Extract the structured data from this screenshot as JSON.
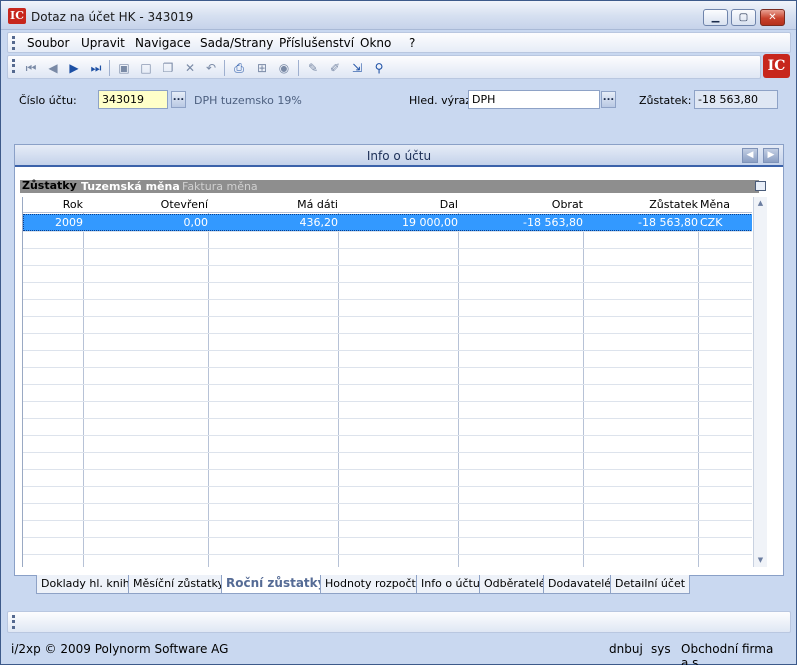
{
  "window": {
    "title": "Dotaz na účet HK - 343019",
    "logo": "IC"
  },
  "menu": [
    "Soubor",
    "Upravit",
    "Navigace",
    "Sada/Strany",
    "Příslušenství",
    "Okno",
    "?"
  ],
  "toolbar_icons": [
    "first-record-icon",
    "previous-record-icon",
    "next-record-icon",
    "last-record-icon",
    "save-icon",
    "new-record-icon",
    "copy-icon",
    "delete-icon",
    "undo-icon",
    "print-icon",
    "tree-icon",
    "globe-icon",
    "edit-icon",
    "highlight-icon",
    "export-icon",
    "filter-icon"
  ],
  "header": {
    "account_label": "Číslo účtu:",
    "account_value": "343019",
    "account_desc": "DPH tuzemsko 19%",
    "search_label": "Hled. výraz:",
    "search_value": "DPH",
    "balance_label": "Zůstatek:",
    "balance_value": "-18 563,80",
    "dots": "..."
  },
  "panel": {
    "title": "Info o účtu",
    "section_label": "Zůstatky",
    "subtabs": [
      "Tuzemská měna",
      "Faktura měna"
    ],
    "columns": [
      "Rok",
      "Otevření",
      "Má dáti",
      "Dal",
      "Obrat",
      "Zůstatek",
      "Měna"
    ],
    "rows": [
      [
        "2009",
        "0,00",
        "436,20",
        "19 000,00",
        "-18 563,80",
        "-18 563,80",
        "CZK"
      ]
    ]
  },
  "tabs": [
    "Doklady hl. knihy",
    "Měsíční zůstatky",
    "Roční zůstatky",
    "Hodnoty rozpočtu",
    "Info o účtu",
    "Odběratelé",
    "Dodavatelé",
    "Detailní účet"
  ],
  "active_tab": "Roční zůstatky",
  "footer": {
    "copyright": "i/2xp © 2009 Polynorm Software AG",
    "user": "dnbuj",
    "system": "sys",
    "company": "Obchodní firma a.s."
  },
  "colors": {
    "selection": "#3399ff",
    "close_button": "#c8412c",
    "accent": "#3b62aa"
  }
}
